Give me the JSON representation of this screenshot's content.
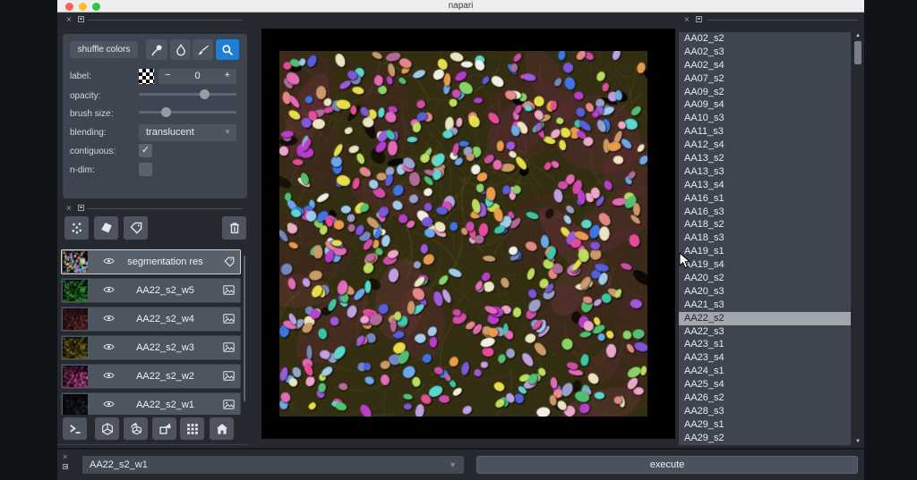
{
  "window": {
    "title": "napari"
  },
  "left_panel": {
    "shuffle_button": "shuffle colors",
    "tools": [
      {
        "name": "color-picker-tool",
        "icon": "eyedropper",
        "active": false
      },
      {
        "name": "fill-tool",
        "icon": "droplet",
        "active": false
      },
      {
        "name": "paint-tool",
        "icon": "paintbrush",
        "active": false
      },
      {
        "name": "zoom-tool",
        "icon": "magnifier",
        "active": true
      }
    ],
    "fields": {
      "label_label": "label:",
      "label_value": "0",
      "minus": "−",
      "plus": "+",
      "opacity_label": "opacity:",
      "opacity_percent": 69,
      "brush_label": "brush size:",
      "brush_percent": 25,
      "blending_label": "blending:",
      "blending_value": "translucent",
      "contiguous_label": "contiguous:",
      "contiguous_checked": true,
      "ndim_label": "n-dim:",
      "ndim_checked": false,
      "check_glyph": "✓",
      "dropdown_arrow": "▼"
    }
  },
  "layer_toolbar": [
    {
      "name": "new-points-layer-button",
      "icon": "points"
    },
    {
      "name": "new-shapes-layer-button",
      "icon": "shapes"
    },
    {
      "name": "new-labels-layer-button",
      "icon": "tag"
    },
    {
      "name": "delete-layer-button",
      "icon": "trash"
    }
  ],
  "layers": [
    {
      "name": "segmentation res",
      "type": "labels",
      "selected": true,
      "thumb": {
        "bg": "#0a0a0c",
        "colors": [
          "#e060c0",
          "#60c8f0",
          "#f0e050",
          "#60e090",
          "#b080f0",
          "#f0f0e0",
          "#f08060"
        ],
        "dots": 150
      }
    },
    {
      "name": "AA22_s2_w5",
      "type": "image",
      "selected": false,
      "thumb": {
        "bg": "#061206",
        "colors": [
          "#1d5c22",
          "#2f9135",
          "#123812",
          "#3fae3f"
        ],
        "dots": 170
      }
    },
    {
      "name": "AA22_s2_w4",
      "type": "image",
      "selected": false,
      "thumb": {
        "bg": "#180a0c",
        "colors": [
          "#4a2026",
          "#6e3038",
          "#35161a"
        ],
        "dots": 170
      }
    },
    {
      "name": "AA22_s2_w3",
      "type": "image",
      "selected": false,
      "thumb": {
        "bg": "#141004",
        "colors": [
          "#4a4416",
          "#6e6420",
          "#2e2a0e",
          "#8a7a28"
        ],
        "dots": 170
      }
    },
    {
      "name": "AA22_s2_w2",
      "type": "image",
      "selected": false,
      "thumb": {
        "bg": "#170711",
        "colors": [
          "#8f2f6b",
          "#c24f96",
          "#5c1f42"
        ],
        "dots": 170
      }
    },
    {
      "name": "AA22_s2_w1",
      "type": "image",
      "selected": false,
      "thumb": {
        "bg": "#070709",
        "colors": [
          "#16161e",
          "#24242e"
        ],
        "dots": 90
      }
    }
  ],
  "viewer_toolbar": [
    {
      "name": "console-button",
      "icon": "console"
    },
    {
      "name": "ndisplay-button",
      "icon": "cube"
    },
    {
      "name": "roll-dimensions-button",
      "icon": "rollcube"
    },
    {
      "name": "transpose-button",
      "icon": "transpose"
    },
    {
      "name": "grid-view-button",
      "icon": "grid"
    },
    {
      "name": "home-button",
      "icon": "home"
    }
  ],
  "image_list": {
    "items": [
      "AA02_s2",
      "AA02_s3",
      "AA02_s4",
      "AA07_s2",
      "AA09_s2",
      "AA09_s4",
      "AA10_s3",
      "AA11_s3",
      "AA12_s4",
      "AA13_s2",
      "AA13_s3",
      "AA13_s4",
      "AA16_s1",
      "AA16_s3",
      "AA18_s2",
      "AA18_s3",
      "AA19_s1",
      "AA19_s4",
      "AA20_s2",
      "AA20_s3",
      "AA21_s3",
      "AA22_s2",
      "AA22_s3",
      "AA23_s1",
      "AA23_s4",
      "AA24_s1",
      "AA25_s4",
      "AA26_s2",
      "AA28_s3",
      "AA29_s1",
      "AA29_s2"
    ],
    "selected": "AA22_s2"
  },
  "bottom_bar": {
    "dropdown_value": "AA22_s2_w1",
    "execute_label": "execute"
  },
  "colors": {
    "accent_blue": "#1f7fd4",
    "selection_gray": "#a2a7ae",
    "traffic_red": "#ff5f57",
    "traffic_yellow": "#febc2e",
    "traffic_green": "#28c840"
  },
  "cell_canvas": {
    "bg": "#332d12",
    "fiber_colors": [
      "#5a541c",
      "#6e6822",
      "#4a4416",
      "#7a7026"
    ],
    "patch_colors": [
      "rgba(150,62,94,0.22)",
      "rgba(118,42,72,0.26)",
      "rgba(90,30,55,0.22)"
    ],
    "nuclei_count": 560,
    "nuclei_palette": [
      "#f5afd4",
      "#ee6fc0",
      "#d94fb2",
      "#c13fd6",
      "#a45de8",
      "#8459e0",
      "#5a63e6",
      "#3f7bf0",
      "#6fb1f2",
      "#a8d4f5",
      "#5fe0d8",
      "#3ecfae",
      "#54c878",
      "#8edc6e",
      "#c3e860",
      "#f2e84e",
      "#f5efc9",
      "#fdfaf0",
      "#f2a24f",
      "#ef8d8d",
      "#d4a06e",
      "#c9a7ec",
      "#9fa8d4",
      "#f04fa0",
      "#b86fa0",
      "#7a8cc9"
    ]
  }
}
